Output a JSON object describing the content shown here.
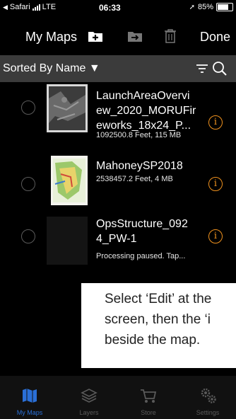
{
  "status_bar": {
    "back_app": "Safari",
    "network": "LTE",
    "time": "06:33",
    "battery": "85%",
    "battery_level": 0.85
  },
  "nav": {
    "title": "My Maps",
    "done_label": "Done",
    "icons": [
      "add-map-icon",
      "export-map-icon",
      "trash-icon"
    ]
  },
  "sort": {
    "label": "Sorted By Name ▼"
  },
  "maps": [
    {
      "title": "LaunchAreaOvervi ew_2020_MORUFir eworks_18x24_P...",
      "meta": "1092500.8 Feet, 115 MB"
    },
    {
      "title": "MahoneySP2018",
      "meta": "2538457.2 Feet, 4 MB"
    },
    {
      "title": "OpsStructure_092 4_PW-1",
      "meta": "Processing paused. Tap..."
    }
  ],
  "overlay": {
    "line1": "Select ‘Edit’ at the",
    "line2": "screen, then the ‘i",
    "line3": "beside the map."
  },
  "tabs": [
    {
      "label": "My Maps",
      "icon": "my-maps-icon"
    },
    {
      "label": "Layers",
      "icon": "layers-icon"
    },
    {
      "label": "Store",
      "icon": "store-cart-icon"
    },
    {
      "label": "Settings",
      "icon": "settings-gears-icon"
    }
  ],
  "colors": {
    "accent_orange": "#f0921e",
    "active_tab_blue": "#2a6fd6",
    "sort_bar_bg": "#3b3b3b"
  }
}
